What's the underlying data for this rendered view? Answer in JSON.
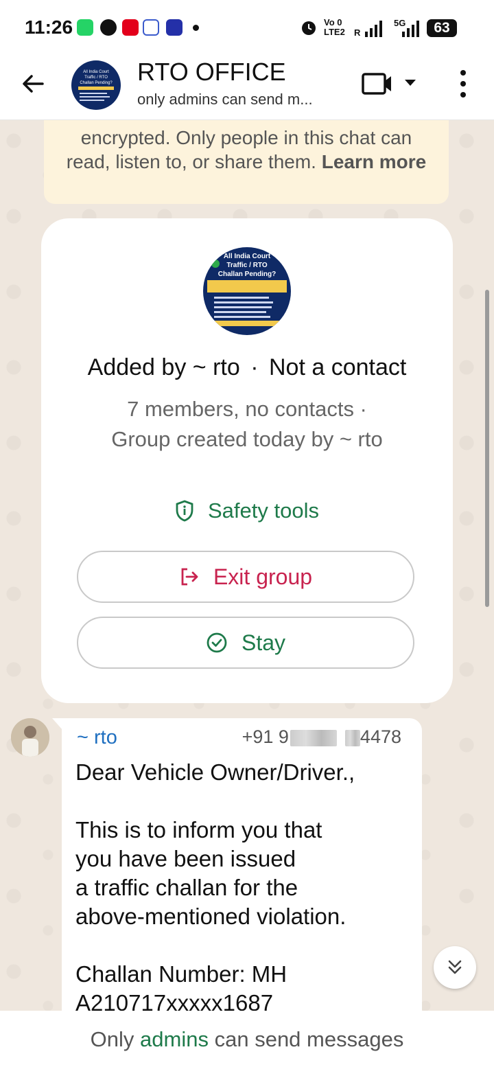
{
  "status_bar": {
    "time": "11:26",
    "battery": "63",
    "network_top": "Vo 0",
    "network_bottom": "LTE2",
    "roaming": "R",
    "fiveg": "5G"
  },
  "header": {
    "title": "RTO OFFICE",
    "subtitle": "only admins can send m...",
    "avatar_text": {
      "line1": "All India Court",
      "line2": "Traffic / RTO",
      "line3": "Challan Pending?"
    }
  },
  "encryption_notice": {
    "text": "encrypted. Only people in this chat can read, listen to, or share them.",
    "link": "Learn more"
  },
  "group_card": {
    "added_by": "Added by ~ rto",
    "not_contact": "Not a contact",
    "separator": "·",
    "members_line": "7 members, no contacts ·",
    "created_line": "Group created today by ~ rto",
    "safety_tools": "Safety tools",
    "exit_group": "Exit group",
    "stay": "Stay"
  },
  "message": {
    "sender": "~ rto",
    "phone_prefix": "+91 9",
    "phone_suffix": "4478",
    "text": "Dear Vehicle Owner/Driver.,\n\nThis is to inform you that\nyou have been issued\na traffic challan for the\nabove-mentioned violation.\n\nChallan Number: MH\nA210717xxxxx1687"
  },
  "footer": {
    "prefix": "Only",
    "link": "admins",
    "suffix": "can send messages"
  },
  "colors": {
    "accent_green": "#1e7a4a",
    "danger_red": "#c8234f",
    "sender_blue": "#1f6fc0",
    "notice_bg": "#fdf3dc",
    "wallpaper": "#efe7de"
  },
  "icons": [
    "back-arrow-icon",
    "video-call-icon",
    "chevron-down-icon",
    "more-options-icon",
    "shield-icon",
    "exit-icon",
    "check-circle-icon",
    "double-chevron-down-icon",
    "whatsapp-icon",
    "message-icon",
    "bag-icon",
    "qr-icon",
    "app-icon",
    "alarm-icon",
    "signal-icon"
  ]
}
